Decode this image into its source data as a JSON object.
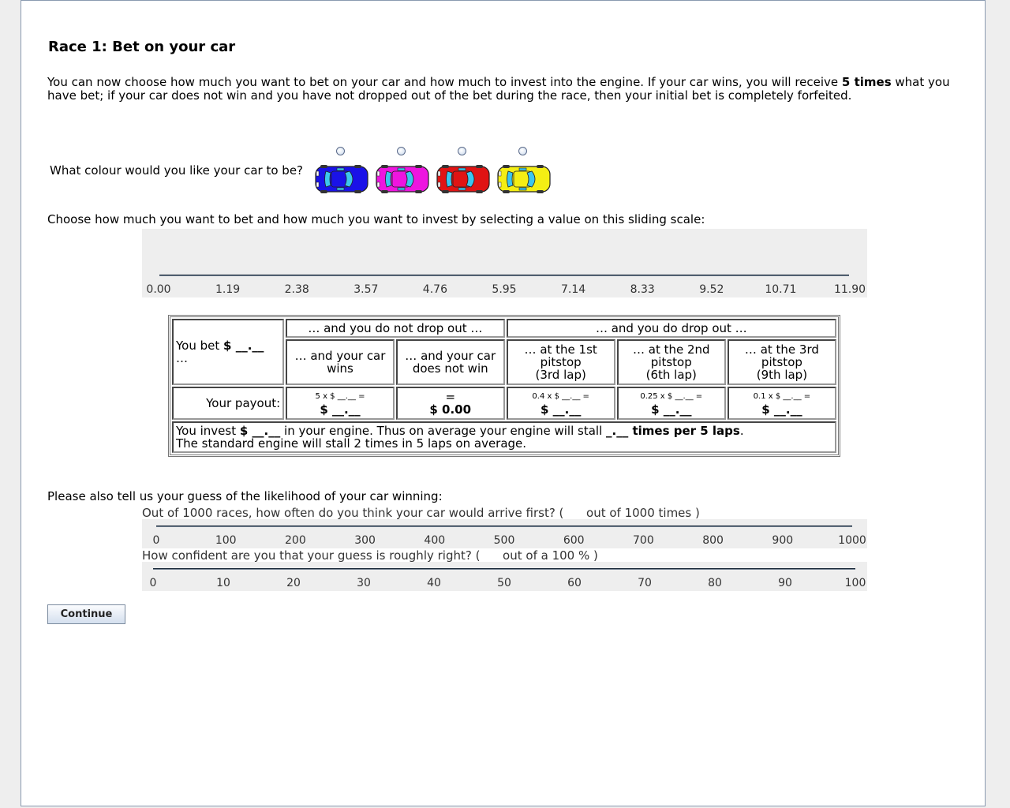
{
  "page": {
    "title": "Race 1: Bet on your car",
    "intro_part1": "You can now choose how much you want to bet on your car and how much to invest into the engine. If your car wins, you will receive ",
    "intro_bold": "5 times",
    "intro_part2": " what you have bet; if your car does not win and you have not dropped out of the bet during the race, then your initial bet is completely forfeited."
  },
  "car_choice": {
    "question": "What colour would you like your car to be?",
    "cars": [
      {
        "name": "blue",
        "color": "#1a12e8"
      },
      {
        "name": "magenta",
        "color": "#ee15e0"
      },
      {
        "name": "red",
        "color": "#e01414"
      },
      {
        "name": "yellow",
        "color": "#f4ee14"
      }
    ]
  },
  "bet_slider": {
    "prompt": "Choose how much you want to bet and how much you want to invest by selecting a value on this sliding scale:",
    "ticks": [
      "0.00",
      "1.19",
      "2.38",
      "3.57",
      "4.76",
      "5.95",
      "7.14",
      "8.33",
      "9.52",
      "10.71",
      "11.90"
    ]
  },
  "table": {
    "you_bet": "You bet",
    "you_bet_amount": "$ __.__",
    "you_bet_ellipsis": "…",
    "no_drop_header": "… and you do not drop out …",
    "drop_header": "… and you do drop out …",
    "col_wins": "… and your car wins",
    "col_not_win": "… and your car does not win",
    "col_pit1_a": "… at the 1st pitstop",
    "col_pit1_b": "(3rd lap)",
    "col_pit2_a": "… at the 2nd pitstop",
    "col_pit2_b": "(6th lap)",
    "col_pit3_a": "… at the 3rd pitstop",
    "col_pit3_b": "(9th lap)",
    "payout_label": "Your payout:",
    "payouts": [
      {
        "formula": "5 x $ __.__ =",
        "value": "$ __.__"
      },
      {
        "formula": "=",
        "value": "$ 0.00"
      },
      {
        "formula": "0.4 x $ __.__ =",
        "value": "$ __.__"
      },
      {
        "formula": "0.25 x $ __.__ =",
        "value": "$ __.__"
      },
      {
        "formula": "0.1 x $ __.__ =",
        "value": "$ __.__"
      }
    ],
    "invest_prefix": "You invest",
    "invest_amount": "$ __.__",
    "invest_mid": "in your engine. Thus on average your engine will stall",
    "invest_stall": "_.__ times per 5 laps",
    "invest_end": ".",
    "standard_engine": "The standard engine will stall 2 times in 5 laps on average."
  },
  "guess": {
    "prompt": "Please also tell us your guess of the likelihood of your car winning:",
    "q1": "Out of 1000 races, how often do you think your car would arrive first? (      out of 1000 times )",
    "q1_ticks": [
      "0",
      "100",
      "200",
      "300",
      "400",
      "500",
      "600",
      "700",
      "800",
      "900",
      "1000"
    ],
    "q2": "How confident are you that your guess is roughly right? (      out of a 100 % )",
    "q2_ticks": [
      "0",
      "10",
      "20",
      "30",
      "40",
      "50",
      "60",
      "70",
      "80",
      "90",
      "100"
    ]
  },
  "continue_label": "Continue"
}
